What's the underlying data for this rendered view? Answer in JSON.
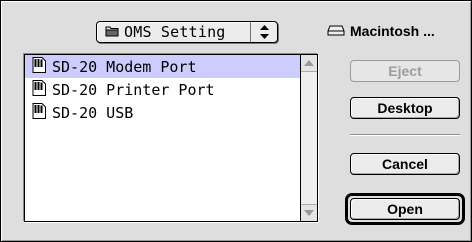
{
  "popup": {
    "label": "OMS Setting",
    "icon": "folder-icon"
  },
  "volume": {
    "label": "Macintosh ...",
    "icon": "hard-disk-icon"
  },
  "files": [
    {
      "name": "SD-20 Modem Port",
      "selected": true
    },
    {
      "name": "SD-20 Printer Port",
      "selected": false
    },
    {
      "name": "SD-20 USB",
      "selected": false
    }
  ],
  "buttons": {
    "eject": "Eject",
    "desktop": "Desktop",
    "cancel": "Cancel",
    "open": "Open"
  },
  "colors": {
    "selection": "#ccccff",
    "dialog": "#dedede"
  }
}
